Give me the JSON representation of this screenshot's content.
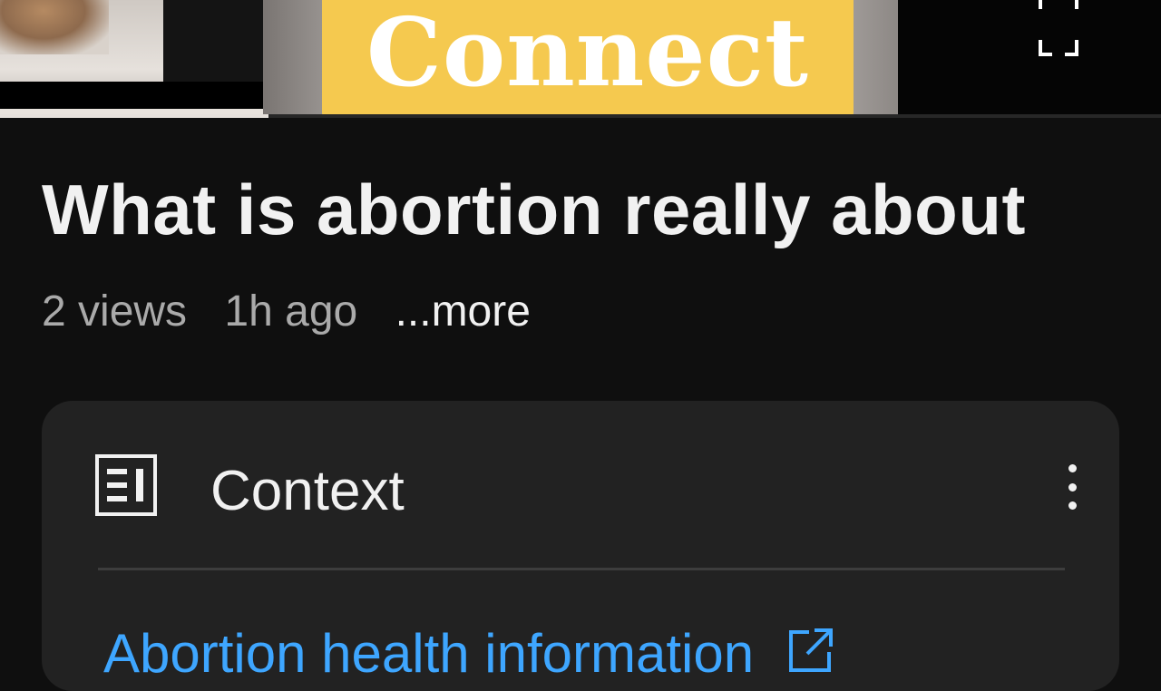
{
  "video": {
    "overlay_text": "Connect",
    "colors": {
      "overlay_card": "#f5c94f",
      "overlay_text": "#ffffff"
    },
    "fullscreen_icon": "fullscreen-icon"
  },
  "details": {
    "title": "What is abortion really about",
    "views": "2 views",
    "age": "1h ago",
    "more_label": "...more"
  },
  "context": {
    "icon": "article-icon",
    "title": "Context",
    "menu_icon": "more-vert-icon",
    "link_label": "Abortion health information",
    "link_icon": "external-link-icon",
    "colors": {
      "card": "#222222",
      "link": "#3ea6ff"
    }
  }
}
